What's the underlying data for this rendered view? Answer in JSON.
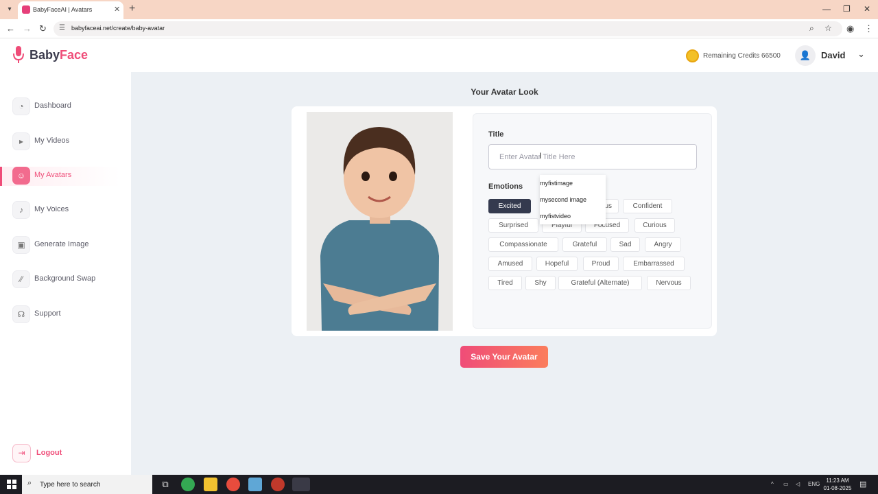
{
  "browser": {
    "tab_title": "BabyFaceAI | Avatars",
    "url": "babyfaceai.net/create/baby-avatar"
  },
  "header": {
    "logo_part1": "Baby",
    "logo_part2": "Face",
    "credits_label": "Remaining Credits 66500",
    "user_name": "David"
  },
  "sidebar": {
    "items": [
      {
        "label": "Dashboard",
        "icon": "chart-icon"
      },
      {
        "label": "My Videos",
        "icon": "video-icon"
      },
      {
        "label": "My Avatars",
        "icon": "user-icon"
      },
      {
        "label": "My Voices",
        "icon": "mic-icon"
      },
      {
        "label": "Generate Image",
        "icon": "image-icon"
      },
      {
        "label": "Background Swap",
        "icon": "swap-icon"
      },
      {
        "label": "Support",
        "icon": "headset-icon"
      }
    ],
    "logout": "Logout"
  },
  "main": {
    "page_title": "Your Avatar Look",
    "title_label": "Title",
    "title_placeholder": "Enter Avatar Title Here",
    "emotions_label": "Emotions",
    "emotions": [
      "Excited",
      "us",
      "Confident",
      "Surprised",
      "Playful",
      "Focused",
      "Curious",
      "Compassionate",
      "Grateful",
      "Sad",
      "Angry",
      "Amused",
      "Hopeful",
      "Proud",
      "Embarrassed",
      "Tired",
      "Shy",
      "Grateful (Alternate)",
      "Nervous"
    ],
    "selected_emotion": "Excited",
    "autocomplete": [
      "myfistimage",
      "mysecond image",
      "myfistvideo"
    ],
    "save_button": "Save Your Avatar"
  },
  "taskbar": {
    "search_placeholder": "Type here to search",
    "language": "ENG",
    "time": "11:23 AM",
    "date": "01-08-2025"
  },
  "colors": {
    "accent": "#ef4c78",
    "accent_end": "#fb7d5c",
    "chip_selected": "#343a4e",
    "main_bg": "#ecf0f4"
  }
}
